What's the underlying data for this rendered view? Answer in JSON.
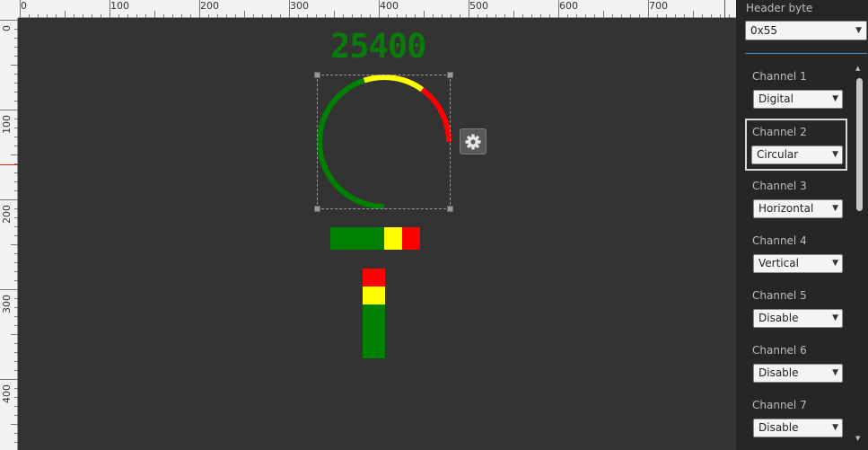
{
  "ruler": {
    "top_labels": [
      "0",
      "100",
      "200",
      "300",
      "400",
      "500",
      "600",
      "700"
    ],
    "left_labels": [
      "0",
      "100",
      "200",
      "300",
      "400"
    ]
  },
  "canvas": {
    "readout_value": "25400",
    "gauge": {
      "type": "circular",
      "level": 0.75,
      "zone_colors": [
        "#008000",
        "#ffff00",
        "#ff0000"
      ]
    },
    "horizontal_bar": {
      "segment_colors": [
        "#008000",
        "#ffff00",
        "#ff0000"
      ],
      "segment_fractions": [
        0.6,
        0.2,
        0.2
      ]
    },
    "vertical_bar": {
      "segment_colors_top_to_bottom": [
        "#ff0000",
        "#ffff00",
        "#008000"
      ],
      "segment_fractions": [
        0.2,
        0.2,
        0.6
      ]
    },
    "settings_icon": "gear-icon"
  },
  "panel": {
    "header_label": "Header byte",
    "header_value": "0x55",
    "channels": [
      {
        "label": "Channel 1",
        "value": "Digital"
      },
      {
        "label": "Channel 2",
        "value": "Circular",
        "selected": true
      },
      {
        "label": "Channel 3",
        "value": "Horizontal"
      },
      {
        "label": "Channel 4",
        "value": "Vertical"
      },
      {
        "label": "Channel 5",
        "value": "Disable"
      },
      {
        "label": "Channel 6",
        "value": "Disable"
      },
      {
        "label": "Channel 7",
        "value": "Disable"
      }
    ]
  },
  "colors": {
    "accent": "#3a8fd9",
    "readout": "#0a7a0a",
    "ruler_marker": "#dd2222"
  }
}
